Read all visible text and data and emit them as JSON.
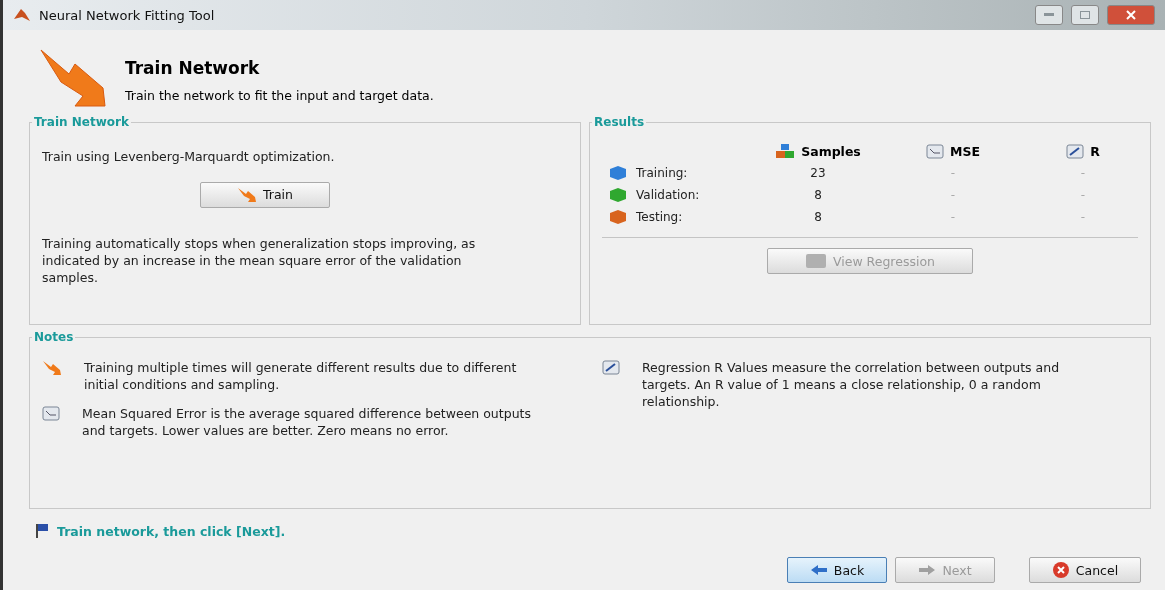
{
  "window": {
    "title": "Neural Network Fitting Tool"
  },
  "header": {
    "title": "Train Network",
    "subtitle": "Train the network to fit the input and target data."
  },
  "train_panel": {
    "title": "Train Network",
    "method": "Train using Levenberg-Marquardt optimization.",
    "button": {
      "label": "Train",
      "disabled": false
    },
    "note": "Training automatically stops when generalization stops improving, as indicated by an increase in the mean square error of the validation samples."
  },
  "results_panel": {
    "title": "Results",
    "columns": [
      {
        "label": "Samples",
        "kind": "samples"
      },
      {
        "label": "MSE",
        "kind": "mse"
      },
      {
        "label": "R",
        "kind": "r"
      }
    ],
    "rows": [
      {
        "label": "Training:",
        "color": "#2f7fd8",
        "samples": "23",
        "mse": "-",
        "r": "-"
      },
      {
        "label": "Validation:",
        "color": "#2fa82f",
        "samples": "8",
        "mse": "-",
        "r": "-"
      },
      {
        "label": "Testing:",
        "color": "#d8641e",
        "samples": "8",
        "mse": "-",
        "r": "-"
      }
    ],
    "button": {
      "label": "View Regression",
      "disabled": true
    }
  },
  "notes_panel": {
    "title": "Notes",
    "notes": [
      {
        "kind": "train",
        "text": "Training multiple times will generate different results due to different initial conditions and sampling."
      },
      {
        "kind": "mse",
        "text": "Mean Squared Error is the average squared difference between outputs and targets. Lower values are better. Zero means no error."
      },
      {
        "kind": "r",
        "text": "Regression R Values measure the correlation between outputs and targets. An R value of 1 means a close relationship, 0 a random relationship."
      }
    ]
  },
  "status_message": "Train network, then click [Next].",
  "buttons": [
    {
      "label": "Back",
      "kind": "back",
      "disabled": false
    },
    {
      "label": "Next",
      "kind": "next",
      "disabled": true
    },
    {
      "label": "Cancel",
      "kind": "cancel",
      "disabled": false
    }
  ]
}
